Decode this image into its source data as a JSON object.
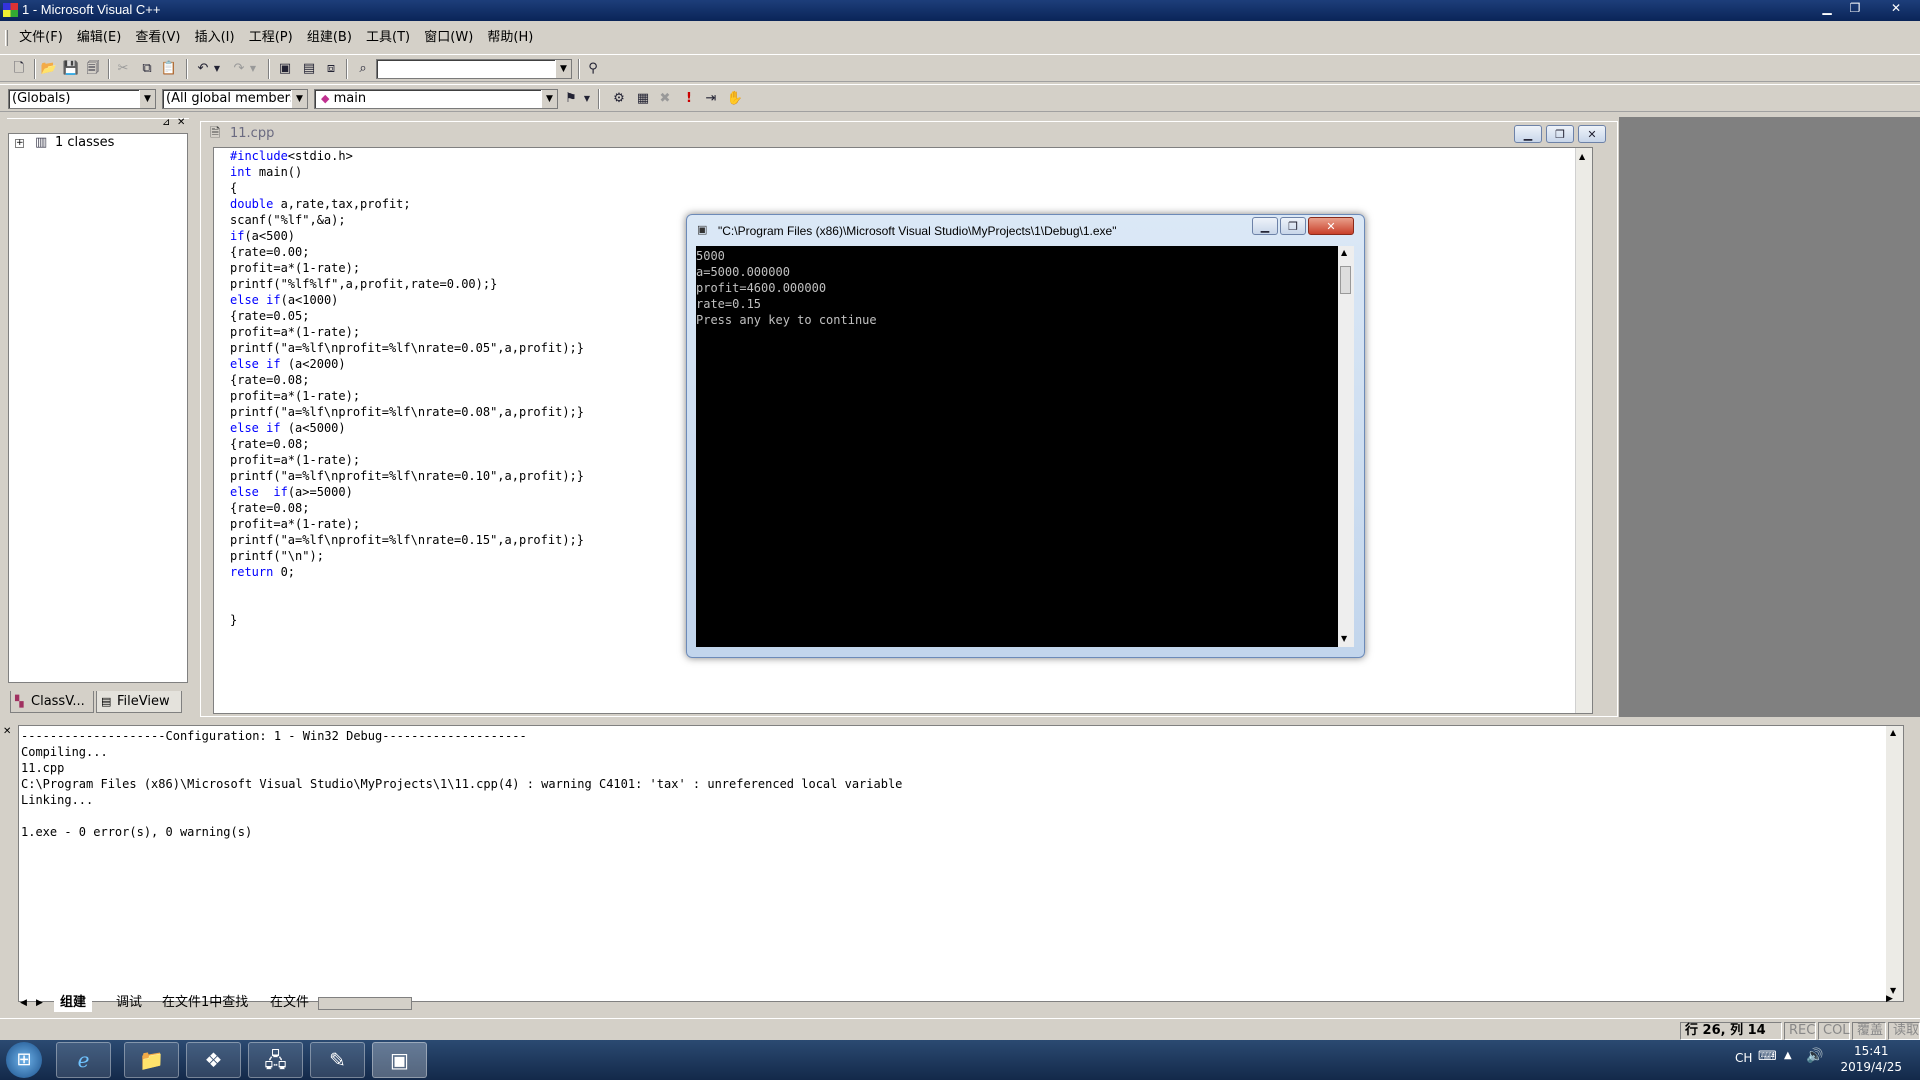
{
  "window": {
    "title": "1 - Microsoft Visual C++"
  },
  "menu": [
    {
      "label": "文件(F)"
    },
    {
      "label": "编辑(E)"
    },
    {
      "label": "查看(V)"
    },
    {
      "label": "插入(I)"
    },
    {
      "label": "工程(P)"
    },
    {
      "label": "组建(B)"
    },
    {
      "label": "工具(T)"
    },
    {
      "label": "窗口(W)"
    },
    {
      "label": "帮助(H)"
    }
  ],
  "toolbar2": {
    "globals": "(Globals)",
    "members": "(All global members",
    "function": "main"
  },
  "workspace": {
    "tree_root": "1 classes",
    "tabs": [
      {
        "label": "ClassV..."
      },
      {
        "label": "FileView"
      }
    ]
  },
  "editor": {
    "tab_title": "11.cpp",
    "code": [
      "#include<stdio.h>",
      "int main()",
      "{",
      "double a,rate,tax,profit;",
      "scanf(\"%lf\",&a);",
      "if(a<500)",
      "{rate=0.00;",
      "profit=a*(1-rate);",
      "printf(\"%lf%lf\",a,profit,rate=0.00);}",
      "else if(a<1000)",
      "{rate=0.05;",
      "profit=a*(1-rate);",
      "printf(\"a=%lf\\nprofit=%lf\\nrate=0.05\",a,profit);}",
      "else if (a<2000)",
      "{rate=0.08;",
      "profit=a*(1-rate);",
      "printf(\"a=%lf\\nprofit=%lf\\nrate=0.08\",a,profit);}",
      "else if (a<5000)",
      "{rate=0.08;",
      "profit=a*(1-rate);",
      "printf(\"a=%lf\\nprofit=%lf\\nrate=0.10\",a,profit);}",
      "else  if(a>=5000)",
      "{rate=0.08;",
      "profit=a*(1-rate);",
      "printf(\"a=%lf\\nprofit=%lf\\nrate=0.15\",a,profit);}",
      "printf(\"\\n\");",
      "return 0;",
      "",
      "",
      "}"
    ]
  },
  "console": {
    "title": "\"C:\\Program Files (x86)\\Microsoft Visual Studio\\MyProjects\\1\\Debug\\1.exe\"",
    "lines": [
      "5000",
      "a=5000.000000",
      "profit=4600.000000",
      "rate=0.15",
      "Press any key to continue"
    ]
  },
  "output": {
    "lines": [
      "--------------------Configuration: 1 - Win32 Debug--------------------",
      "Compiling...",
      "11.cpp",
      "C:\\Program Files (x86)\\Microsoft Visual Studio\\MyProjects\\1\\11.cpp(4) : warning C4101: 'tax' : unreferenced local variable",
      "Linking...",
      "",
      "1.exe - 0 error(s), 0 warning(s)"
    ],
    "tabs": [
      {
        "label": "组建"
      },
      {
        "label": "调试"
      },
      {
        "label": "在文件1中查找"
      },
      {
        "label": "在文件"
      }
    ]
  },
  "status": {
    "position": "行 26, 列 14",
    "rec": "REC",
    "col": "COL",
    "ovr": "覆盖",
    "read": "读取"
  },
  "taskbar": {
    "lang": "CH",
    "time": "15:41",
    "date": "2019/4/25"
  },
  "colors": {
    "keyword": "#0000ff",
    "console_bg": "#000000",
    "taskbar": "#1e3a5f"
  }
}
